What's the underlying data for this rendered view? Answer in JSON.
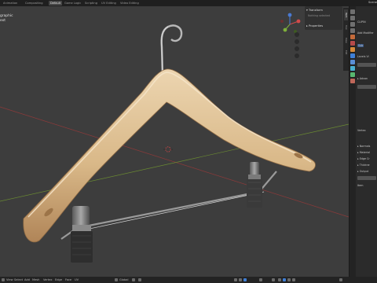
{
  "topbar": {
    "tabs": [
      "Animation",
      "Compositing",
      "Default",
      "Game Logic",
      "Scripting",
      "UV Editing",
      "Video Editing"
    ],
    "active_tab": "Default",
    "scene": "Scene"
  },
  "viewport": {
    "view_label_1": "graphic",
    "view_label_2": "ext"
  },
  "npanel": {
    "transform_header": "Transform",
    "nothing_selected": "Nothing selected",
    "properties_header": "Properties",
    "tabs": [
      "Item",
      "Tool",
      "View",
      "Edit"
    ]
  },
  "properties": {
    "object_name": "CLIPIN",
    "add_modifier": "Add Modifier",
    "sub": "Sub",
    "levels_viewport": "Levels Vi",
    "advanced": "Advan",
    "vertex": "Vertex",
    "sections": [
      "Normals",
      "Material",
      "Edge Cr",
      "Thickne",
      "Output"
    ],
    "item": "Item"
  },
  "bottombar": {
    "menus": [
      "View",
      "Select",
      "Add",
      "Mesh",
      "Vertex",
      "Edge",
      "Face",
      "UV"
    ],
    "orientation": "Global"
  },
  "colors": {
    "viewport_bg": "#3d3d3d",
    "active_tab": "#474747",
    "wood_light": "#e4c8a0",
    "wood_dark": "#b58a5c",
    "x_axis": "#8c3a3a",
    "y_axis": "#6a8a32"
  }
}
